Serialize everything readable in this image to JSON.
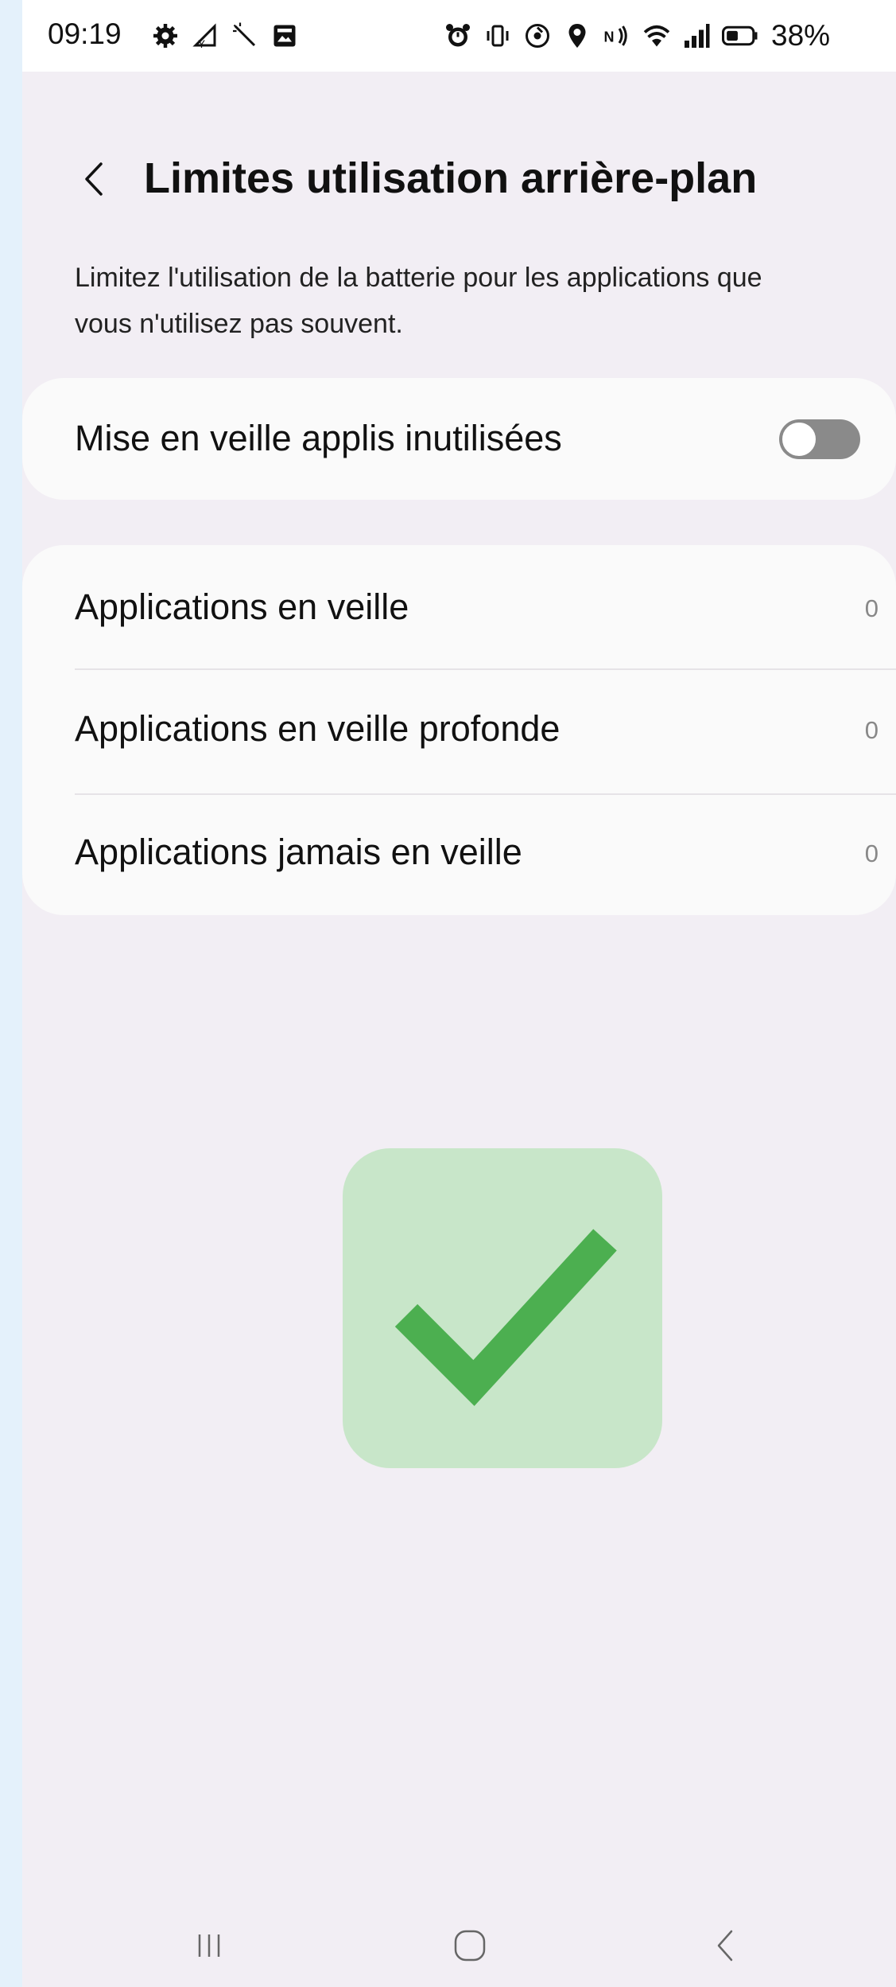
{
  "status_bar": {
    "time": "09:19",
    "battery_percent": "38%",
    "left_icons": [
      "settings-icon",
      "signal-data-icon",
      "magic-wand-icon",
      "image-icon"
    ],
    "right_icons": [
      "alarm-icon",
      "vibrate-icon",
      "data-saver-icon",
      "location-icon",
      "nfc-icon",
      "wifi-icon",
      "cellular-signal-icon",
      "battery-icon"
    ]
  },
  "header": {
    "back_icon": "chevron-left-icon",
    "title": "Limites utilisation arrière-plan"
  },
  "description": "Limitez l'utilisation de la batterie pour les applications que vous n'utilisez pas souvent.",
  "toggle_setting": {
    "label": "Mise en veille applis inutilisées",
    "state": "off"
  },
  "app_lists": [
    {
      "label": "Applications en veille",
      "count": "0"
    },
    {
      "label": "Applications en veille profonde",
      "count": "0"
    },
    {
      "label": "Applications jamais en veille",
      "count": "0"
    }
  ],
  "overlay": {
    "icon": "checkmark-icon",
    "color": "#4caf50",
    "background": "#c8e6c9"
  },
  "nav_bar": {
    "recents_icon": "recents-icon",
    "home_icon": "home-icon",
    "back_icon": "back-icon"
  },
  "colors": {
    "page_background": "#f2eef4",
    "card_background": "#fafafa",
    "toggle_off": "#8a8a8a"
  }
}
